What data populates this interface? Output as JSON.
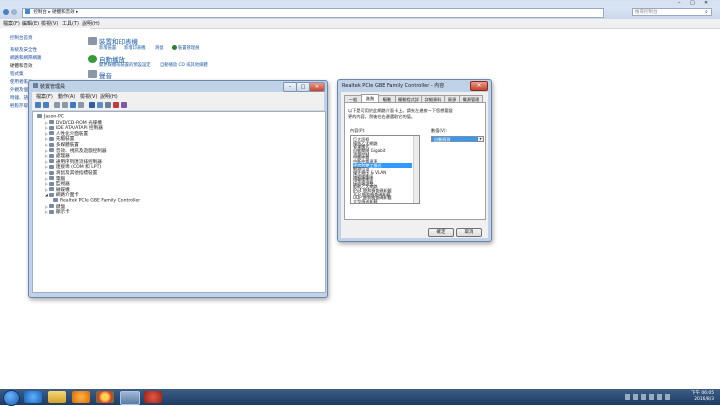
{
  "control_panel": {
    "breadcrumb": [
      "控制台",
      "硬體和音效"
    ],
    "search_placeholder": "搜尋控制台",
    "menu": [
      "檔案(F)",
      "編輯(E)",
      "檢視(V)",
      "工具(T)",
      "說明(H)"
    ],
    "sidebar": [
      "控制台首頁",
      "系統及安全性",
      "網路和網際網路",
      "硬體和音效",
      "程式集",
      "使用者帳戶",
      "外觀及個人化",
      "時鐘、語言",
      "輕鬆存取"
    ],
    "sections": [
      {
        "title": "裝置和印表機",
        "links": [
          "新增裝置",
          "新增印表機",
          "滑鼠",
          "裝置管理員"
        ]
      },
      {
        "title": "自動播放",
        "links": [
          "變更媒體或裝置的預設設定",
          "自動播放 CD 或其他媒體"
        ]
      },
      {
        "title": "聲音",
        "links": []
      }
    ]
  },
  "device_manager": {
    "title": "裝置管理員",
    "menu": [
      "檔案(F)",
      "動作(A)",
      "檢視(V)",
      "說明(H)"
    ],
    "tree": [
      {
        "level": 0,
        "label": "Jason-PC"
      },
      {
        "level": 1,
        "label": "DVD/CD-ROM 光碟機"
      },
      {
        "level": 1,
        "label": "IDE ATA/ATAPI 控制器"
      },
      {
        "level": 1,
        "label": "人性化介面裝置"
      },
      {
        "level": 1,
        "label": "先驅裝置"
      },
      {
        "level": 1,
        "label": "多媒體裝置"
      },
      {
        "level": 1,
        "label": "音效、視訊及遊戲控制器"
      },
      {
        "level": 1,
        "label": "處理器"
      },
      {
        "level": 1,
        "label": "通用序列匯流排控制器"
      },
      {
        "level": 1,
        "label": "連接埠 (COM 和 LPT)"
      },
      {
        "level": 1,
        "label": "滑鼠及其他指標裝置"
      },
      {
        "level": 1,
        "label": "電腦"
      },
      {
        "level": 1,
        "label": "監視器"
      },
      {
        "level": 1,
        "label": "磁碟機"
      },
      {
        "level": 1,
        "label": "網路介面卡"
      },
      {
        "level": 2,
        "label": "Realtek PCIe GBE Family Controller"
      },
      {
        "level": 1,
        "label": "鍵盤"
      },
      {
        "level": 1,
        "label": "顯示卡"
      }
    ]
  },
  "properties_dialog": {
    "title": "Realtek PCIe GBE Family Controller - 內容",
    "close_label": "✕",
    "tabs": [
      "一般",
      "進階",
      "驅動",
      "驅動程式詳細",
      "詳細資料",
      "資源",
      "電源管理"
    ],
    "active_tab": 1,
    "description": [
      "以下是可用於此網路介面卡上。請先左邊按一下您想要變",
      "更的內容，然後在右邊選取它的值。"
    ],
    "property_label": "內容(P):",
    "value_label": "數值(V):",
    "properties": [
      "巨大訊框",
      "綠色乙太網路",
      "省電模式",
      "自動關閉 Gigabit",
      "流量控制",
      "中斷仲裁",
      "中斷仲裁速率",
      "速度和雙工模式",
      "網路位址",
      "優先順序 & VLAN",
      "接收緩衝區",
      "傳輸緩衝區",
      "接收端調整",
      "節能乙太網路",
      "IPv4 總和檢查碼卸載",
      "TCP 總和檢查碼卸載",
      "UDP 總和檢查碼卸載",
      "大型傳送卸載"
    ],
    "selected_property": 7,
    "value_selected": "自動偵測",
    "ok_label": "確定",
    "cancel_label": "取消"
  },
  "taskbar": {
    "time": "下午 06:05",
    "date": "2016/8/3"
  }
}
